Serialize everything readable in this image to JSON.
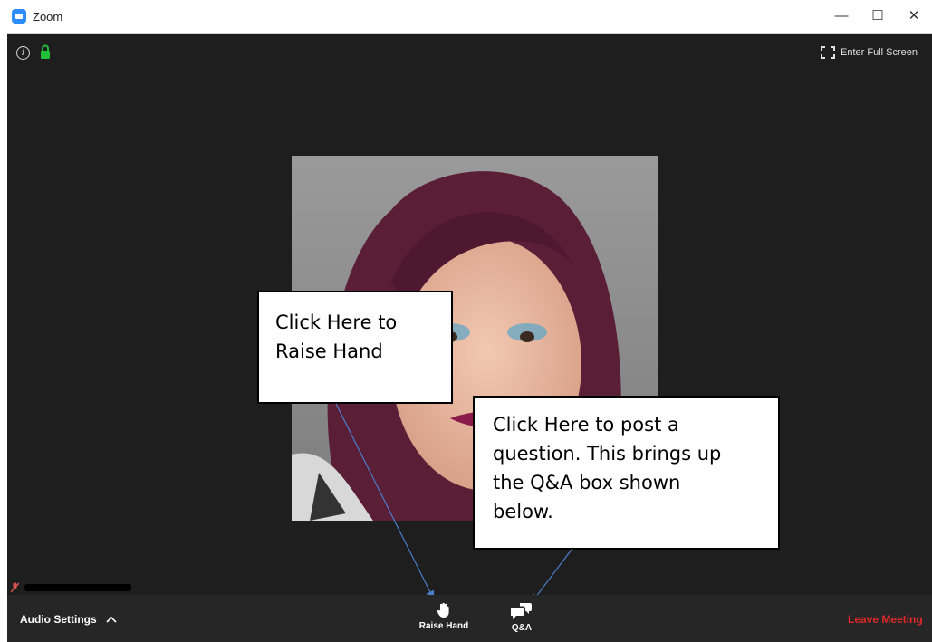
{
  "window": {
    "title": "Zoom",
    "minimize_glyph": "—",
    "maximize_glyph": "☐",
    "close_glyph": "✕"
  },
  "meeting": {
    "info_glyph": "i",
    "fullscreen_label": "Enter Full Screen"
  },
  "callouts": {
    "raise_hand": [
      "Click Here to",
      "Raise Hand"
    ],
    "qa": [
      "Click Here to post a",
      "question. This brings up",
      "the Q&A box shown",
      "below."
    ]
  },
  "toolbar": {
    "audio_settings_label": "Audio Settings",
    "raise_hand_label": "Raise Hand",
    "qa_label": "Q&A",
    "leave_label": "Leave Meeting"
  },
  "colors": {
    "accent": "#2d8cff",
    "leave": "#e02828",
    "secure": "#1fbf3a",
    "arrow": "#4a7fc8"
  },
  "icons": [
    "info-icon",
    "lock-icon",
    "fullscreen-icon",
    "muted-mic-icon",
    "caret-up-icon",
    "hand-icon",
    "chat-bubbles-icon"
  ]
}
